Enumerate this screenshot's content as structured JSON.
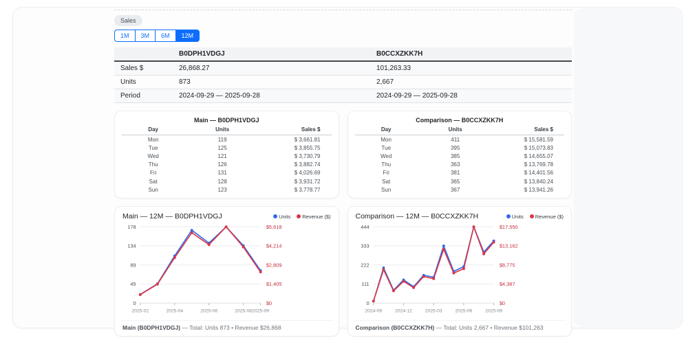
{
  "accent_colors": {
    "primary_blue": "#0d6efd",
    "chart_blue": "#2f6beb",
    "chart_red": "#dc3545",
    "right_axis_label": "#c2303e"
  },
  "tab_badge": {
    "label": "Sales"
  },
  "range_buttons": [
    {
      "label": "1M",
      "active": false
    },
    {
      "label": "3M",
      "active": false
    },
    {
      "label": "6M",
      "active": false
    },
    {
      "label": "12M",
      "active": true
    }
  ],
  "summary_table": {
    "columns": [
      "",
      "B0DPH1VDGJ",
      "B0CCXZKK7H"
    ],
    "rows": [
      {
        "label": "Sales $",
        "main": "26,868.27",
        "comparison": "101,263.33"
      },
      {
        "label": "Units",
        "main": "873",
        "comparison": "2,667"
      },
      {
        "label": "Period",
        "main": "2024-09-29 — 2025-09-28",
        "comparison": "2024-09-29 — 2025-09-28"
      }
    ]
  },
  "day_tables": [
    {
      "title": "Main — B0DPH1VDGJ",
      "columns": [
        "Day",
        "Units",
        "Sales $"
      ],
      "rows": [
        [
          "Mon",
          "119",
          "$ 3,661.81"
        ],
        [
          "Tue",
          "125",
          "$ 3,855.75"
        ],
        [
          "Wed",
          "121",
          "$ 3,730.79"
        ],
        [
          "Thu",
          "126",
          "$ 3,882.74"
        ],
        [
          "Fri",
          "131",
          "$ 4,026.69"
        ],
        [
          "Sat",
          "128",
          "$ 3,931.72"
        ],
        [
          "Sun",
          "123",
          "$ 3,778.77"
        ]
      ]
    },
    {
      "title": "Comparison — B0CCXZKK7H",
      "columns": [
        "Day",
        "Units",
        "Sales $"
      ],
      "rows": [
        [
          "Mon",
          "411",
          "$ 15,581.59"
        ],
        [
          "Tue",
          "395",
          "$ 15,073.83"
        ],
        [
          "Wed",
          "385",
          "$ 14,655.07"
        ],
        [
          "Thu",
          "363",
          "$ 13,769.78"
        ],
        [
          "Fri",
          "381",
          "$ 14,401.56"
        ],
        [
          "Sat",
          "365",
          "$ 13,840.24"
        ],
        [
          "Sun",
          "367",
          "$ 13,941.26"
        ]
      ]
    }
  ],
  "chart_data": [
    {
      "type": "line",
      "title": "Main — 12M — B0DPH1VDGJ",
      "legend": [
        {
          "name": "Units",
          "color": "#2f6beb"
        },
        {
          "name": "Revenue ($)",
          "color": "#dc3545"
        }
      ],
      "x": [
        "2025-02",
        "2025-03",
        "2025-04",
        "2025-05",
        "2025-06",
        "2025-07",
        "2025-08",
        "2025-09"
      ],
      "x_ticks": [
        {
          "index": 0,
          "label": "2025-02"
        },
        {
          "index": 2,
          "label": "2025-04"
        },
        {
          "index": 4,
          "label": "2025-06"
        },
        {
          "index": 6,
          "label": "2025-08"
        },
        {
          "index": 7,
          "label": "2025-09"
        }
      ],
      "left_axis": {
        "max": 178,
        "ticks": [
          "0",
          "45",
          "89",
          "134",
          "178"
        ]
      },
      "right_axis": {
        "max": 5618,
        "ticks": [
          "$0",
          "$1,405",
          "$2,809",
          "$4,214",
          "$5,618"
        ]
      },
      "series": [
        {
          "name": "Units",
          "axis": "left",
          "color": "#2f6beb",
          "values": [
            20,
            45,
            110,
            170,
            140,
            178,
            134,
            76
          ]
        },
        {
          "name": "Revenue ($)",
          "axis": "right",
          "color": "#dc3545",
          "values": [
            620,
            1390,
            3340,
            5180,
            4300,
            5618,
            4130,
            2290
          ]
        }
      ],
      "footer_bold": "Main (B0DPH1VDGJ)",
      "footer_rest": " — Total: Units 873  •  Revenue $26,868"
    },
    {
      "type": "line",
      "title": "Comparison — 12M — B0CCXZKK7H",
      "legend": [
        {
          "name": "Units",
          "color": "#2f6beb"
        },
        {
          "name": "Revenue ($)",
          "color": "#dc3545"
        }
      ],
      "x": [
        "2024-09",
        "2024-10",
        "2024-11",
        "2024-12",
        "2025-01",
        "2025-02",
        "2025-03",
        "2025-04",
        "2025-05",
        "2025-06",
        "2025-07",
        "2025-08",
        "2025-09"
      ],
      "x_ticks": [
        {
          "index": 0,
          "label": "2024-09"
        },
        {
          "index": 3,
          "label": "2024-12"
        },
        {
          "index": 6,
          "label": "2025-03"
        },
        {
          "index": 9,
          "label": "2025-06"
        },
        {
          "index": 12,
          "label": "2025-09"
        }
      ],
      "left_axis": {
        "max": 444,
        "ticks": [
          "0",
          "111",
          "222",
          "333",
          "444"
        ]
      },
      "right_axis": {
        "max": 17550,
        "ticks": [
          "$0",
          "$4,387",
          "$8,775",
          "$13,162",
          "$17,550"
        ]
      },
      "series": [
        {
          "name": "Units",
          "axis": "left",
          "color": "#2f6beb",
          "values": [
            12,
            205,
            75,
            135,
            95,
            162,
            150,
            333,
            185,
            212,
            444,
            297,
            362
          ]
        },
        {
          "name": "Revenue ($)",
          "axis": "right",
          "color": "#dc3545",
          "values": [
            450,
            7700,
            2800,
            5000,
            3550,
            6100,
            5600,
            12400,
            6900,
            7900,
            17550,
            11300,
            14013
          ]
        }
      ],
      "footer_bold": "Comparison (B0CCXZKK7H)",
      "footer_rest": " — Total: Units 2,667  •  Revenue $101,263"
    }
  ]
}
